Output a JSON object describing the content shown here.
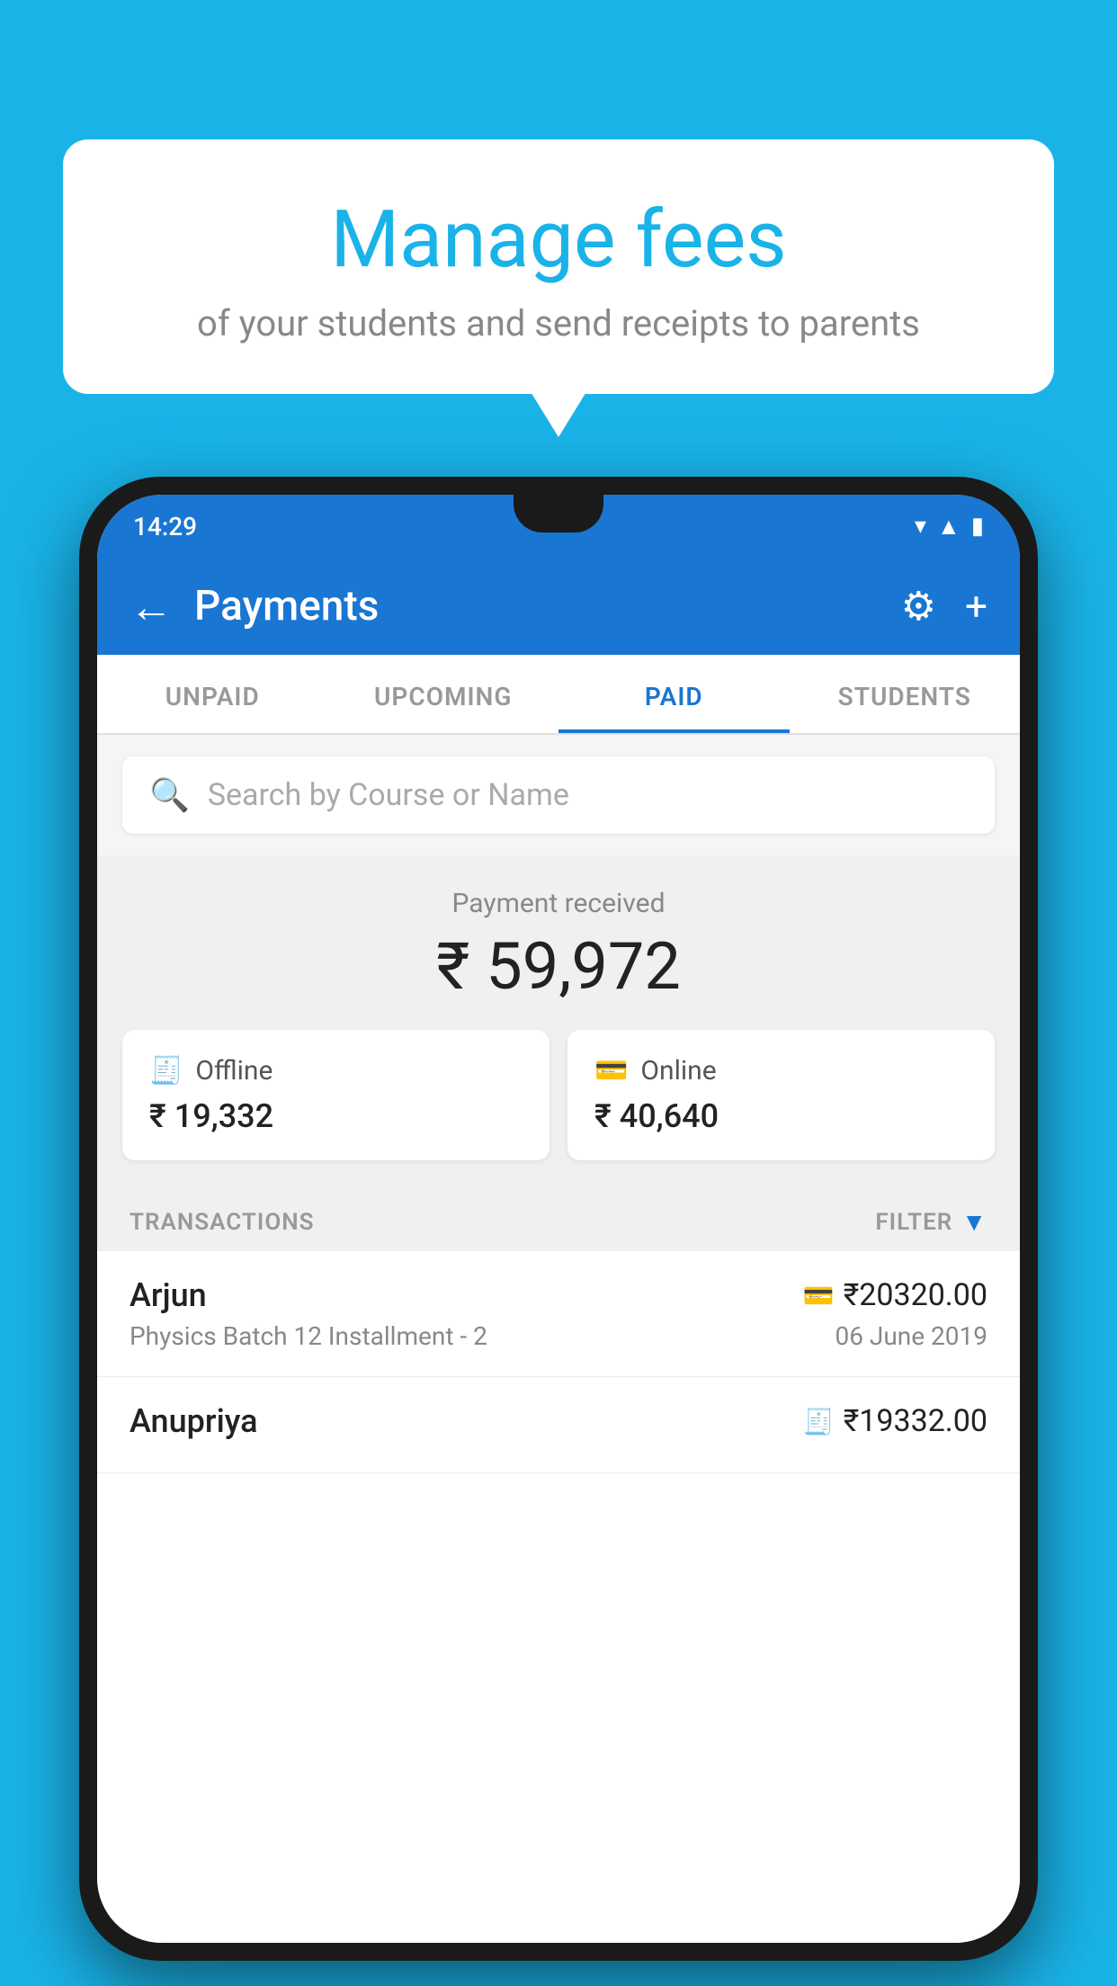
{
  "background_color": "#1ab3e8",
  "bubble": {
    "title": "Manage fees",
    "subtitle": "of your students and send receipts to parents"
  },
  "phone": {
    "status_bar": {
      "time": "14:29"
    },
    "top_bar": {
      "title": "Payments",
      "back_label": "←",
      "gear_label": "⚙",
      "plus_label": "+"
    },
    "tabs": [
      {
        "label": "UNPAID",
        "active": false
      },
      {
        "label": "UPCOMING",
        "active": false
      },
      {
        "label": "PAID",
        "active": true
      },
      {
        "label": "STUDENTS",
        "active": false
      }
    ],
    "search": {
      "placeholder": "Search by Course or Name"
    },
    "payment_received": {
      "label": "Payment received",
      "amount": "₹ 59,972"
    },
    "cards": [
      {
        "icon": "💳",
        "label": "Offline",
        "amount": "₹ 19,332"
      },
      {
        "icon": "💳",
        "label": "Online",
        "amount": "₹ 40,640"
      }
    ],
    "transactions_label": "TRANSACTIONS",
    "filter_label": "FILTER",
    "transactions": [
      {
        "name": "Arjun",
        "course": "Physics Batch 12 Installment - 2",
        "amount": "₹20320.00",
        "date": "06 June 2019",
        "icon": "💳"
      },
      {
        "name": "Anupriya",
        "course": "",
        "amount": "₹19332.00",
        "date": "",
        "icon": "💵"
      }
    ]
  }
}
